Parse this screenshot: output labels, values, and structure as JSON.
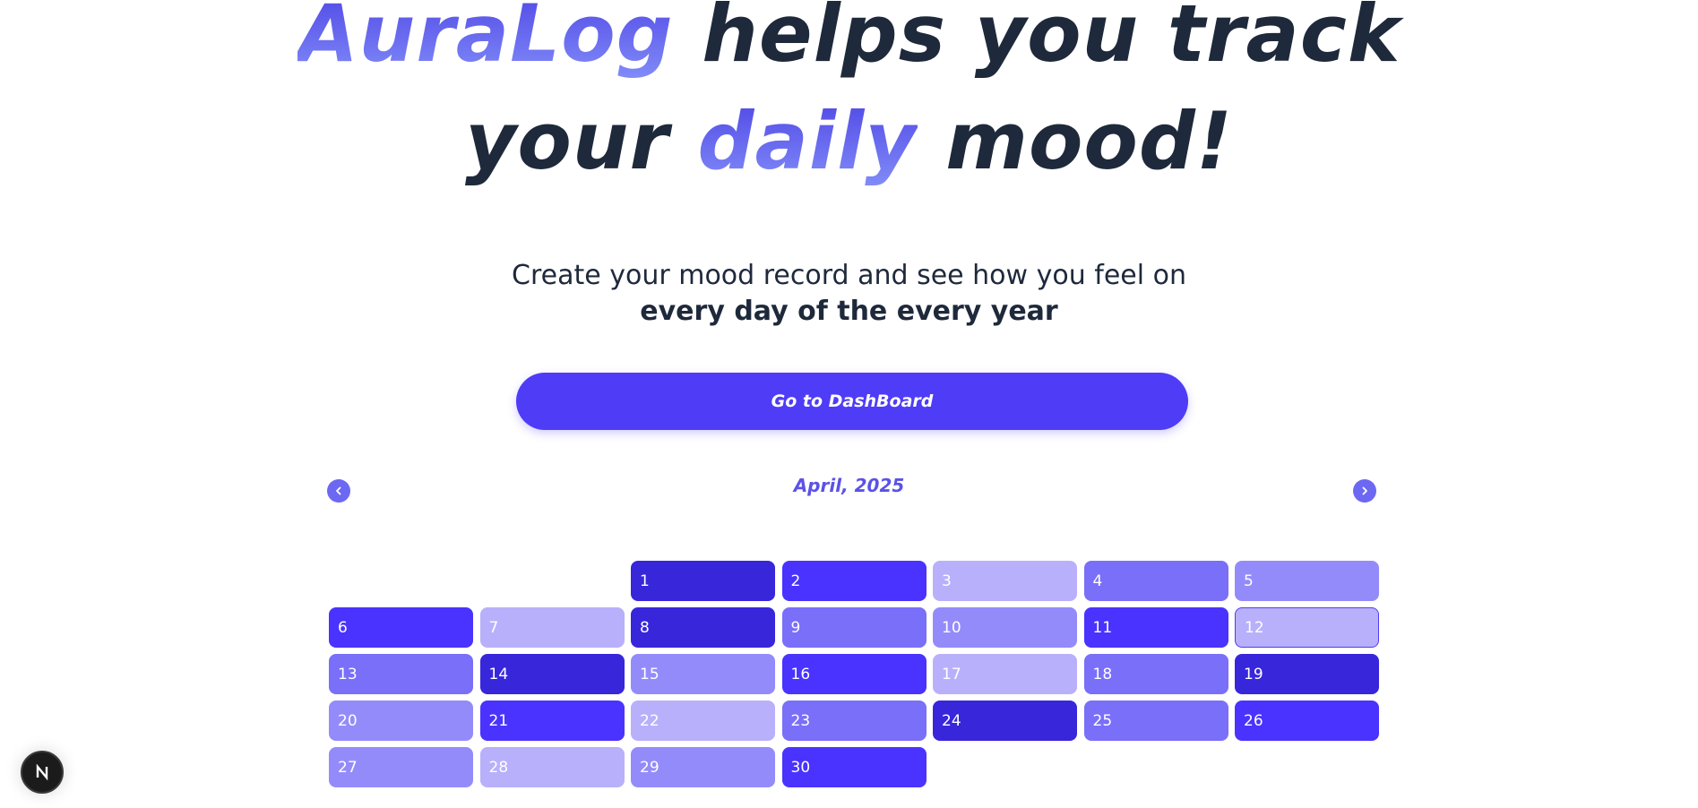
{
  "hero": {
    "brand": "AuraLog",
    "line1_rest": " helps you track",
    "line2_start": "your ",
    "line2_accent": "daily",
    "line2_end": " mood!",
    "subtitle_line1": "Create your mood record and see how you feel on",
    "subtitle_line2": "every day of the every year",
    "cta_label": "Go to DashBoard"
  },
  "calendar": {
    "month_label": "April, 2025",
    "leading_blanks": 2,
    "today": 12,
    "days": [
      {
        "day": "1",
        "level": 5
      },
      {
        "day": "2",
        "level": 4
      },
      {
        "day": "3",
        "level": 1
      },
      {
        "day": "4",
        "level": 3
      },
      {
        "day": "5",
        "level": 2
      },
      {
        "day": "6",
        "level": 4
      },
      {
        "day": "7",
        "level": 1
      },
      {
        "day": "8",
        "level": 5
      },
      {
        "day": "9",
        "level": 3
      },
      {
        "day": "10",
        "level": 2
      },
      {
        "day": "11",
        "level": 4
      },
      {
        "day": "12",
        "level": 1
      },
      {
        "day": "13",
        "level": 3
      },
      {
        "day": "14",
        "level": 5
      },
      {
        "day": "15",
        "level": 2
      },
      {
        "day": "16",
        "level": 4
      },
      {
        "day": "17",
        "level": 1
      },
      {
        "day": "18",
        "level": 3
      },
      {
        "day": "19",
        "level": 5
      },
      {
        "day": "20",
        "level": 2
      },
      {
        "day": "21",
        "level": 4
      },
      {
        "day": "22",
        "level": 1
      },
      {
        "day": "23",
        "level": 3
      },
      {
        "day": "24",
        "level": 5
      },
      {
        "day": "25",
        "level": 3
      },
      {
        "day": "26",
        "level": 4
      },
      {
        "day": "27",
        "level": 2
      },
      {
        "day": "28",
        "level": 1
      },
      {
        "day": "29",
        "level": 2
      },
      {
        "day": "30",
        "level": 4
      }
    ],
    "icons": {
      "prev": "chevron-left-icon",
      "next": "chevron-right-icon"
    }
  },
  "colors": {
    "accent": "#4f3cf7",
    "heading": "#1e293b",
    "level1": "#b9b0fb",
    "level2": "#948bfb",
    "level3": "#7a6ff8",
    "level4": "#4a33ff",
    "level5": "#3826db"
  },
  "dev_badge": {
    "label": "N",
    "icon": "nextjs-logo-icon"
  }
}
